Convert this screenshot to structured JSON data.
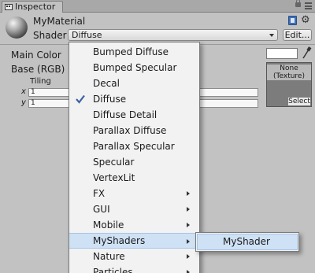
{
  "window": {
    "tab_title": "Inspector"
  },
  "header": {
    "material_name": "MyMaterial",
    "shader_label": "Shader",
    "shader_value": "Diffuse",
    "edit_label": "Edit..."
  },
  "properties": {
    "main_color_label": "Main Color",
    "main_color_value": "#ffffff",
    "base_label": "Base (RGB)",
    "tiling_label": "Tiling",
    "x_axis": "x",
    "y_axis": "y",
    "tiling_x": "1",
    "tiling_y": "1",
    "texture_none": "None",
    "texture_type": "(Texture)",
    "texture_select": "Select"
  },
  "menu": {
    "items": [
      {
        "label": "Bumped Diffuse"
      },
      {
        "label": "Bumped Specular"
      },
      {
        "label": "Decal"
      },
      {
        "label": "Diffuse",
        "checked": true
      },
      {
        "label": "Diffuse Detail"
      },
      {
        "label": "Parallax Diffuse"
      },
      {
        "label": "Parallax Specular"
      },
      {
        "label": "Specular"
      },
      {
        "label": "VertexLit"
      },
      {
        "label": "FX",
        "submenu": true
      },
      {
        "label": "GUI",
        "submenu": true
      },
      {
        "label": "Mobile",
        "submenu": true
      },
      {
        "label": "MyShaders",
        "submenu": true,
        "highlighted": true
      },
      {
        "label": "Nature",
        "submenu": true
      },
      {
        "label": "Particles",
        "submenu": true
      }
    ],
    "submenu_items": [
      {
        "label": "MyShader"
      }
    ]
  },
  "colors": {
    "highlight": "#cfe1f5",
    "panel": "#c2c2c2"
  }
}
